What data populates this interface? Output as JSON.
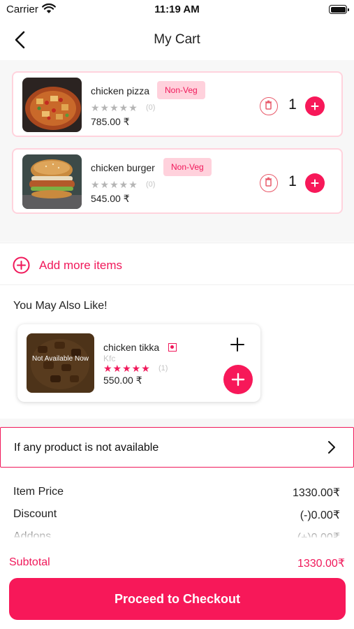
{
  "status_bar": {
    "carrier": "Carrier",
    "time": "11:19 AM"
  },
  "header": {
    "title": "My Cart"
  },
  "cart": {
    "items": [
      {
        "name": "chicken pizza",
        "badge": "Non-Veg",
        "stars": "★★★★★",
        "rating_count": "(0)",
        "price": "785.00 ₹",
        "quantity": "1"
      },
      {
        "name": "chicken burger",
        "badge": "Non-Veg",
        "stars": "★★★★★",
        "rating_count": "(0)",
        "price": "545.00 ₹",
        "quantity": "1"
      }
    ]
  },
  "add_more": {
    "label": "Add more items"
  },
  "recommendations": {
    "title": "You May Also Like!",
    "items": [
      {
        "availability": "Not Available Now",
        "name": "chicken tikka",
        "brand": "Kfc",
        "stars": "★★★★★",
        "rating_count": "(1)",
        "price": "550.00 ₹"
      }
    ]
  },
  "unavailable_option": {
    "label": "If any product is not available"
  },
  "summary": {
    "rows": [
      {
        "label": "Item Price",
        "value": "1330.00₹"
      },
      {
        "label": "Discount",
        "value": "(-)0.00₹"
      },
      {
        "label": "Addons",
        "value": "(+)0.00₹"
      }
    ],
    "subtotal_label": "Subtotal",
    "subtotal_value": "1330.00₹"
  },
  "checkout": {
    "label": "Proceed to Checkout"
  },
  "colors": {
    "accent": "#f71859",
    "accent_text": "#f0185a",
    "badge_bg": "#ffd1dc",
    "card_border": "#ffd3dd"
  }
}
